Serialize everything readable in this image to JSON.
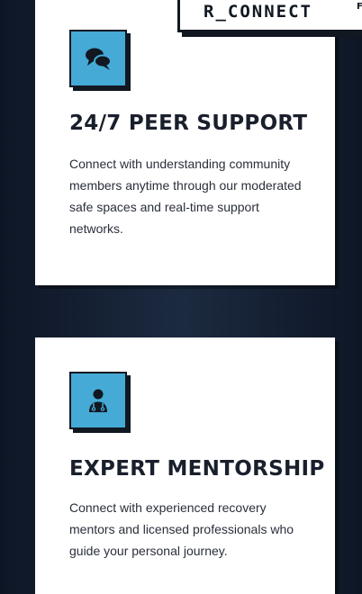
{
  "brand": {
    "name": "R_CONNECT",
    "extra": "F"
  },
  "features": [
    {
      "icon": "chat-bubbles-icon",
      "title": "24/7 PEER SUPPORT",
      "description": "Connect with understanding community members anytime through our moderated safe spaces and real-time support networks."
    },
    {
      "icon": "doctor-icon",
      "title": "EXPERT MENTORSHIP",
      "description": "Connect with experienced recovery mentors and licensed professionals who guide your personal journey."
    }
  ],
  "colors": {
    "icon_background": "#45aad6",
    "page_background": "#16223a",
    "ink": "#111821"
  }
}
